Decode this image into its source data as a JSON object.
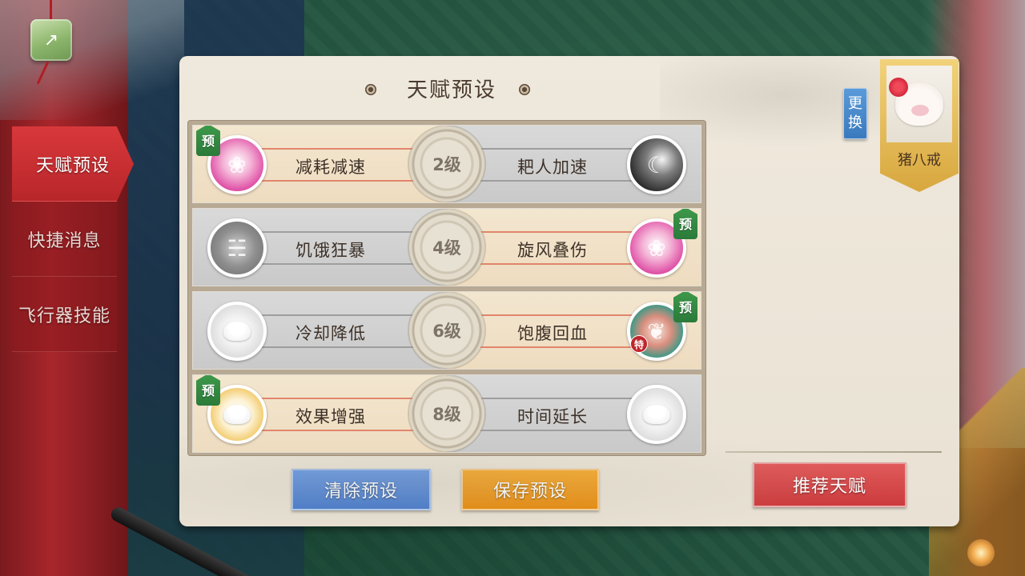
{
  "sidebar": {
    "tabs": [
      {
        "label": "天赋预设",
        "active": true
      },
      {
        "label": "快捷消息",
        "active": false
      },
      {
        "label": "飞行器技能",
        "active": false
      }
    ]
  },
  "panel": {
    "title": "天赋预设"
  },
  "talent_rows": [
    {
      "level": "2级",
      "left": {
        "name": "减耗减速",
        "icon": "pink-swirl-icon",
        "selected": true,
        "preset_badge": "预"
      },
      "right": {
        "name": "耙人加速",
        "icon": "dark-swirl-icon",
        "selected": false
      }
    },
    {
      "level": "4级",
      "left": {
        "name": "饥饿狂暴",
        "icon": "hunger-icon",
        "selected": false
      },
      "right": {
        "name": "旋风叠伤",
        "icon": "pink-swirl-icon",
        "selected": true,
        "preset_badge": "预"
      }
    },
    {
      "level": "6级",
      "left": {
        "name": "冷却降低",
        "icon": "bun-icon",
        "selected": false
      },
      "right": {
        "name": "饱腹回血",
        "icon": "pig-skill-icon",
        "selected": true,
        "preset_badge": "预",
        "special_badge": "特"
      }
    },
    {
      "level": "8级",
      "left": {
        "name": "效果增强",
        "icon": "golden-bun-icon",
        "selected": true,
        "preset_badge": "预"
      },
      "right": {
        "name": "时间延长",
        "icon": "bun-icon",
        "selected": false
      }
    }
  ],
  "buttons": {
    "clear": "清除预设",
    "save": "保存预设",
    "recommend": "推荐天赋"
  },
  "character": {
    "name": "猪八戒",
    "swap_label": [
      "更",
      "换"
    ]
  },
  "colors": {
    "selected_row": "#f3e6cf",
    "unselected_row": "#d4d4d4",
    "clear_button": "#5b8ad6",
    "save_button": "#f09d22",
    "recommend_button": "#d64a4c",
    "active_tab": "#c92e31"
  }
}
